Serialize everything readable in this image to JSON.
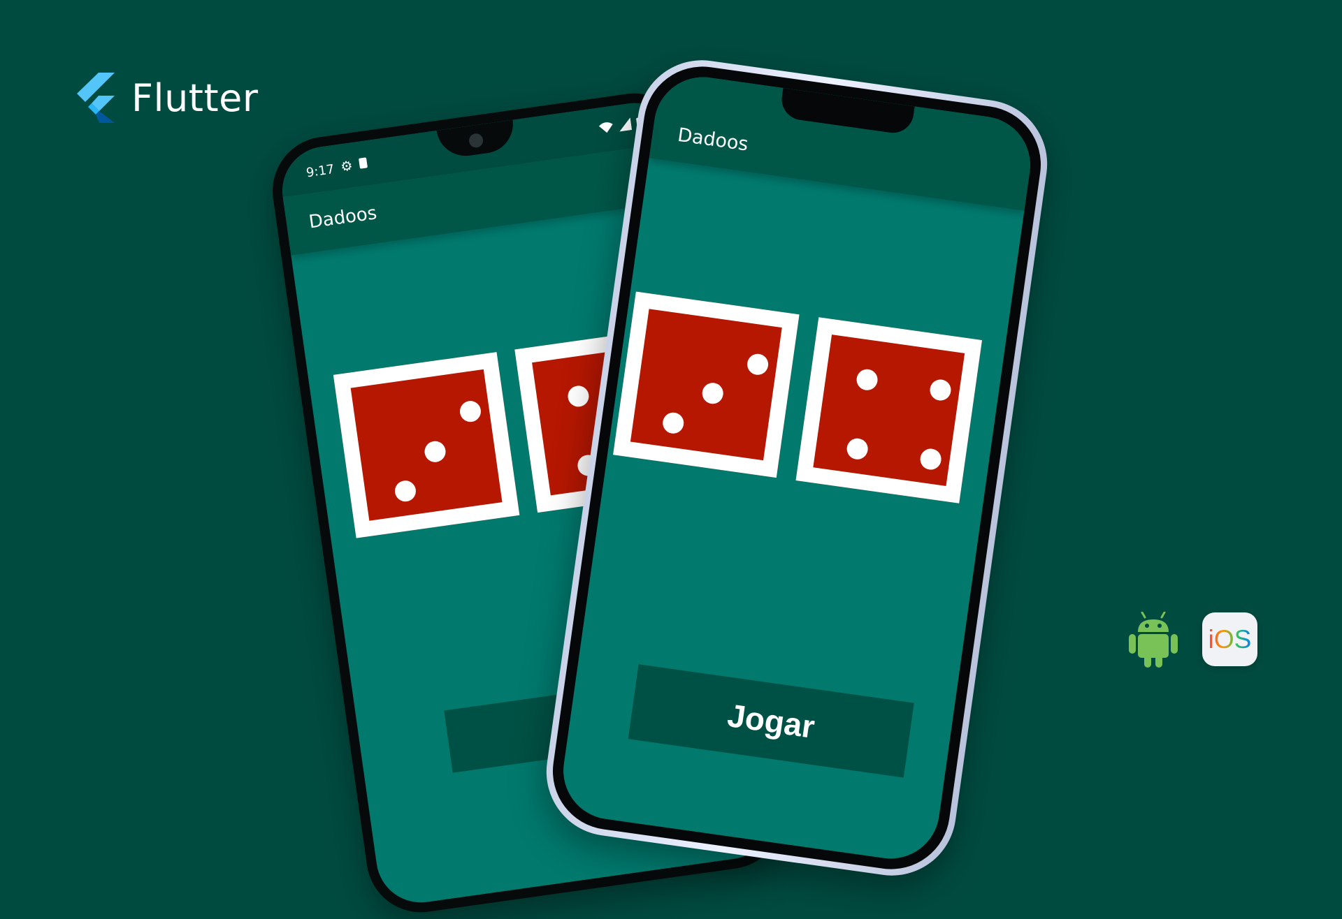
{
  "brand": {
    "name": "Flutter",
    "icon": "flutter-logo-icon",
    "colors": {
      "light": "#54c5f8",
      "dark": "#01579b"
    }
  },
  "android_phone": {
    "status_time": "9:17",
    "status_icons": [
      "settings-icon",
      "sim-card-icon",
      "wifi-icon",
      "signal-icon",
      "battery-icon"
    ],
    "app_title": "Dadoos",
    "dice": [
      {
        "value": 3
      },
      {
        "value": 4
      }
    ],
    "button_label": ""
  },
  "ios_phone": {
    "app_title": "Dadoos",
    "dice": [
      {
        "value": 3
      },
      {
        "value": 4
      }
    ],
    "button_label": "Jogar"
  },
  "platforms": {
    "android_icon": "android-robot-icon",
    "ios_label": "iOS"
  },
  "colors": {
    "background": "#004b40",
    "screen": "#01796d",
    "app_bar": "#005748",
    "button": "#005145",
    "die_red": "#b51700",
    "die_border": "#ffffff",
    "android_green": "#78c257"
  }
}
